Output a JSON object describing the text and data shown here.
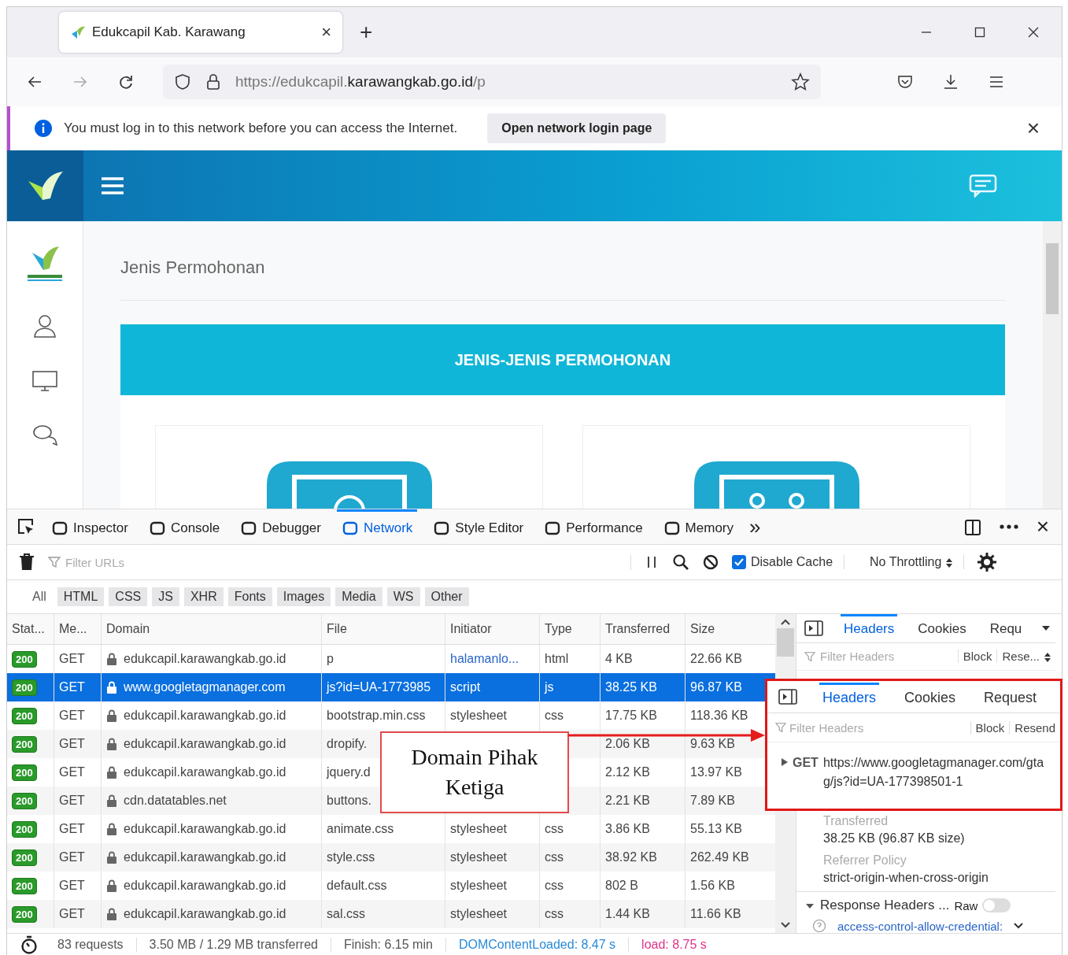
{
  "browser": {
    "tab": {
      "title": "Edukcapil Kab. Karawang",
      "close": "×"
    },
    "new_tab": "+",
    "url": "https://edukcapil.**karawangkab.go.id**/p",
    "notification": {
      "message": "You must log in to this network before you can access the Internet.",
      "button": "Open network login page",
      "close": "×"
    }
  },
  "page": {
    "heading": "Jenis Permohonan",
    "panel_title": "JENIS-JENIS PERMOHONAN"
  },
  "devtools": {
    "tools": [
      {
        "label": "Inspector",
        "selected": false
      },
      {
        "label": "Console",
        "selected": false
      },
      {
        "label": "Debugger",
        "selected": false
      },
      {
        "label": "Network",
        "selected": true
      },
      {
        "label": "Style Editor",
        "selected": false
      },
      {
        "label": "Performance",
        "selected": false
      },
      {
        "label": "Memory",
        "selected": false
      }
    ],
    "more": "»",
    "close": "×",
    "filter_placeholder": "Filter URLs",
    "disable_cache": {
      "label": "Disable Cache",
      "checked": true
    },
    "throttling": "No Throttling",
    "type_filters": [
      {
        "label": "All",
        "selected": true
      },
      {
        "label": "HTML",
        "selected": false
      },
      {
        "label": "CSS",
        "selected": false
      },
      {
        "label": "JS",
        "selected": false
      },
      {
        "label": "XHR",
        "selected": false
      },
      {
        "label": "Fonts",
        "selected": false
      },
      {
        "label": "Images",
        "selected": false
      },
      {
        "label": "Media",
        "selected": false
      },
      {
        "label": "WS",
        "selected": false
      },
      {
        "label": "Other",
        "selected": false
      }
    ],
    "columns": [
      "Stat...",
      "Me...",
      "Domain",
      "File",
      "Initiator",
      "Type",
      "Transferred",
      "Size"
    ],
    "rows": [
      {
        "status": "200",
        "method": "GET",
        "domain": "edukcapil.karawangkab.go.id",
        "file": "p",
        "initiator": "halamanlo...",
        "initiator_link": true,
        "type": "html",
        "transferred": "4 KB",
        "size": "22.66 KB",
        "selected": false
      },
      {
        "status": "200",
        "method": "GET",
        "domain": "www.googletagmanager.com",
        "file": "js?id=UA-1773985",
        "initiator": "script",
        "initiator_link": false,
        "type": "js",
        "transferred": "38.25 KB",
        "size": "96.87 KB",
        "selected": true
      },
      {
        "status": "200",
        "method": "GET",
        "domain": "edukcapil.karawangkab.go.id",
        "file": "bootstrap.min.css",
        "initiator": "stylesheet",
        "initiator_link": false,
        "type": "css",
        "transferred": "17.75 KB",
        "size": "118.36 KB",
        "selected": false
      },
      {
        "status": "200",
        "method": "GET",
        "domain": "edukcapil.karawangkab.go.id",
        "file": "dropify.",
        "transferred": "2.06 KB",
        "size": "9.63 KB",
        "selected": false
      },
      {
        "status": "200",
        "method": "GET",
        "domain": "edukcapil.karawangkab.go.id",
        "file": "jquery.d",
        "transferred": "2.12 KB",
        "size": "13.97 KB",
        "selected": false
      },
      {
        "status": "200",
        "method": "GET",
        "domain": "cdn.datatables.net",
        "file": "buttons.",
        "transferred": "2.21 KB",
        "size": "7.89 KB",
        "selected": false
      },
      {
        "status": "200",
        "method": "GET",
        "domain": "edukcapil.karawangkab.go.id",
        "file": "animate.css",
        "initiator": "stylesheet",
        "initiator_link": false,
        "type": "css",
        "transferred": "3.86 KB",
        "size": "55.13 KB",
        "selected": false
      },
      {
        "status": "200",
        "method": "GET",
        "domain": "edukcapil.karawangkab.go.id",
        "file": "style.css",
        "initiator": "stylesheet",
        "initiator_link": false,
        "type": "css",
        "transferred": "38.92 KB",
        "size": "262.49 KB",
        "selected": false
      },
      {
        "status": "200",
        "method": "GET",
        "domain": "edukcapil.karawangkab.go.id",
        "file": "default.css",
        "initiator": "stylesheet",
        "initiator_link": false,
        "type": "css",
        "transferred": "802 B",
        "size": "1.56 KB",
        "selected": false
      },
      {
        "status": "200",
        "method": "GET",
        "domain": "edukcapil.karawangkab.go.id",
        "file": "sal.css",
        "initiator": "stylesheet",
        "initiator_link": false,
        "type": "css",
        "transferred": "1.44 KB",
        "size": "11.66 KB",
        "selected": false
      }
    ],
    "status_bar": {
      "requests": "83 requests",
      "transferred": "3.50 MB / 1.29 MB transferred",
      "finish": "Finish: 6.15 min",
      "dom_loaded": "DOMContentLoaded: 8.47 s",
      "load": "load: 8.75 s"
    }
  },
  "details_panel": {
    "tabs": [
      {
        "label": "Headers",
        "selected": true
      },
      {
        "label": "Cookies",
        "selected": false
      },
      {
        "label": "Requ",
        "selected": false
      }
    ],
    "filter_placeholder": "Filter Headers",
    "block": "Block",
    "resend": "Rese...",
    "transferred_label": "Transferred",
    "transferred_value": "38.25 KB (96.87 KB size)",
    "referrer_label": "Referrer Policy",
    "referrer_value": "strict-origin-when-cross-origin",
    "response_headers": "Response Headers ...",
    "raw": "Raw",
    "raw_on": false,
    "header_row": "access-control-allow-credential:"
  },
  "annotation": {
    "callout": "Domain Pihak Ketiga",
    "inset": {
      "tabs": [
        {
          "label": "Headers",
          "selected": true
        },
        {
          "label": "Cookies",
          "selected": false
        },
        {
          "label": "Request",
          "selected": false
        }
      ],
      "filter_placeholder": "Filter Headers",
      "block": "Block",
      "resend": "Resend",
      "method": "GET",
      "url": "https://www.googletagmanager.com/gtag/js?id=UA-177398501-1"
    }
  }
}
